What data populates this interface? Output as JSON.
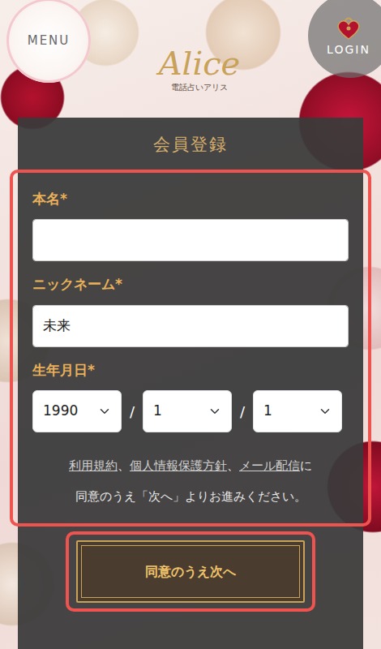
{
  "header": {
    "menu": "MENU",
    "logo": "Alice",
    "logo_sub": "電話占いアリス",
    "login": "LOGIN"
  },
  "form": {
    "title": "会員登録",
    "name": {
      "label": "本名*",
      "value": ""
    },
    "nickname": {
      "label": "ニックネーム*",
      "value": "未来"
    },
    "birthday": {
      "label": "生年月日*",
      "year": "1990",
      "month": "1",
      "day": "1",
      "separators": [
        "/",
        "/"
      ]
    },
    "consent": {
      "line1": [
        {
          "text": "利用規約",
          "link": true
        },
        {
          "text": "、",
          "link": false
        },
        {
          "text": "個人情報保護方針",
          "link": true
        },
        {
          "text": "、",
          "link": false
        },
        {
          "text": "メール配信",
          "link": true
        },
        {
          "text": "に",
          "link": false
        }
      ],
      "line2": "同意のうえ「次へ」よりお進みください。"
    },
    "submit": "同意のうえ次へ"
  }
}
